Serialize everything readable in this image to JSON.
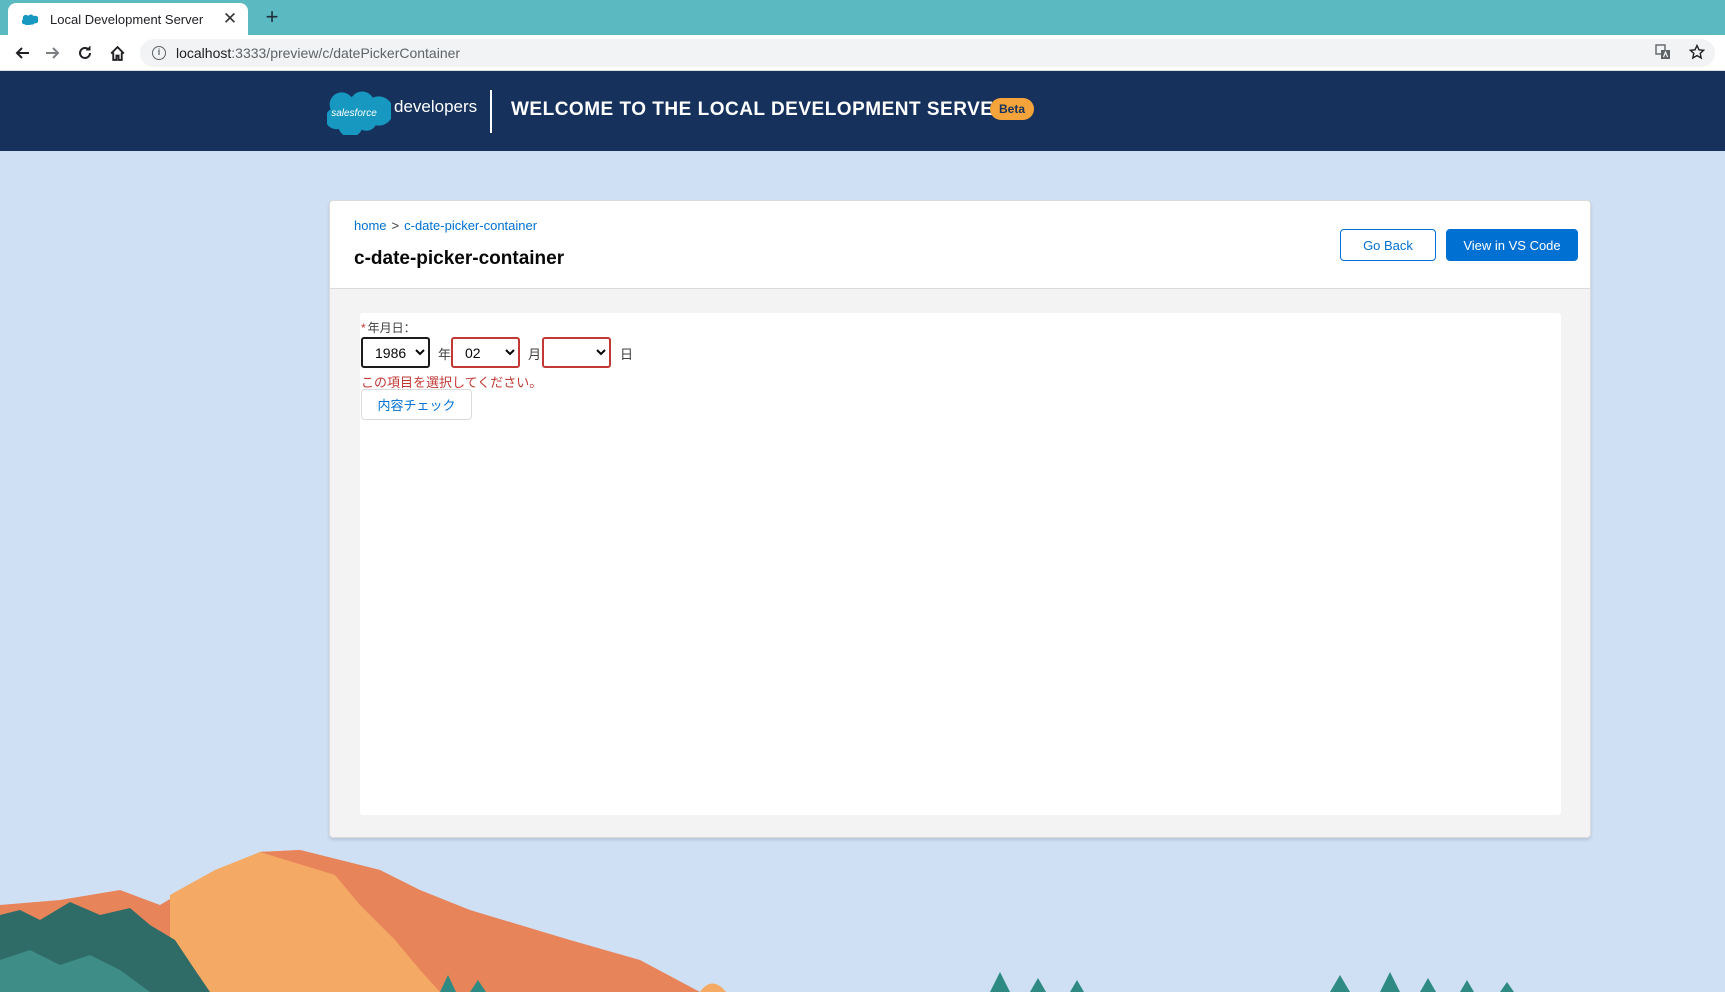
{
  "browser": {
    "tab_title": "Local Development Server",
    "tab_close": "✕",
    "new_tab": "+",
    "url_host": "localhost",
    "url_path": ":3333/preview/c/datePickerContainer"
  },
  "header": {
    "logo_text": "salesforce",
    "developers": "developers",
    "welcome": "WELCOME TO THE LOCAL DEVELOPMENT SERVER",
    "beta": "Beta"
  },
  "card": {
    "breadcrumb": {
      "home": "home",
      "separator": ">",
      "current": "c-date-picker-container"
    },
    "title": "c-date-picker-container",
    "go_back": "Go Back",
    "view_vscode": "View in VS Code"
  },
  "form": {
    "required_mark": "*",
    "label": "年月日：",
    "year_value": "1986",
    "year_unit": "年",
    "month_value": "02",
    "month_unit": "月",
    "day_value": "",
    "day_unit": "日",
    "error": "この項目を選択してください。",
    "check_button": "内容チェック"
  },
  "colors": {
    "header_bg": "#16325c",
    "tabbar_bg": "#5bb9c1",
    "brand_blue": "#0070d2",
    "error_red": "#c23934",
    "beta_orange": "#f4a43b"
  },
  "icons": {
    "back": "arrow-left-icon",
    "forward": "arrow-right-icon",
    "reload": "reload-icon",
    "home": "home-icon",
    "info": "info-icon",
    "translate": "translate-icon",
    "star": "star-icon"
  }
}
